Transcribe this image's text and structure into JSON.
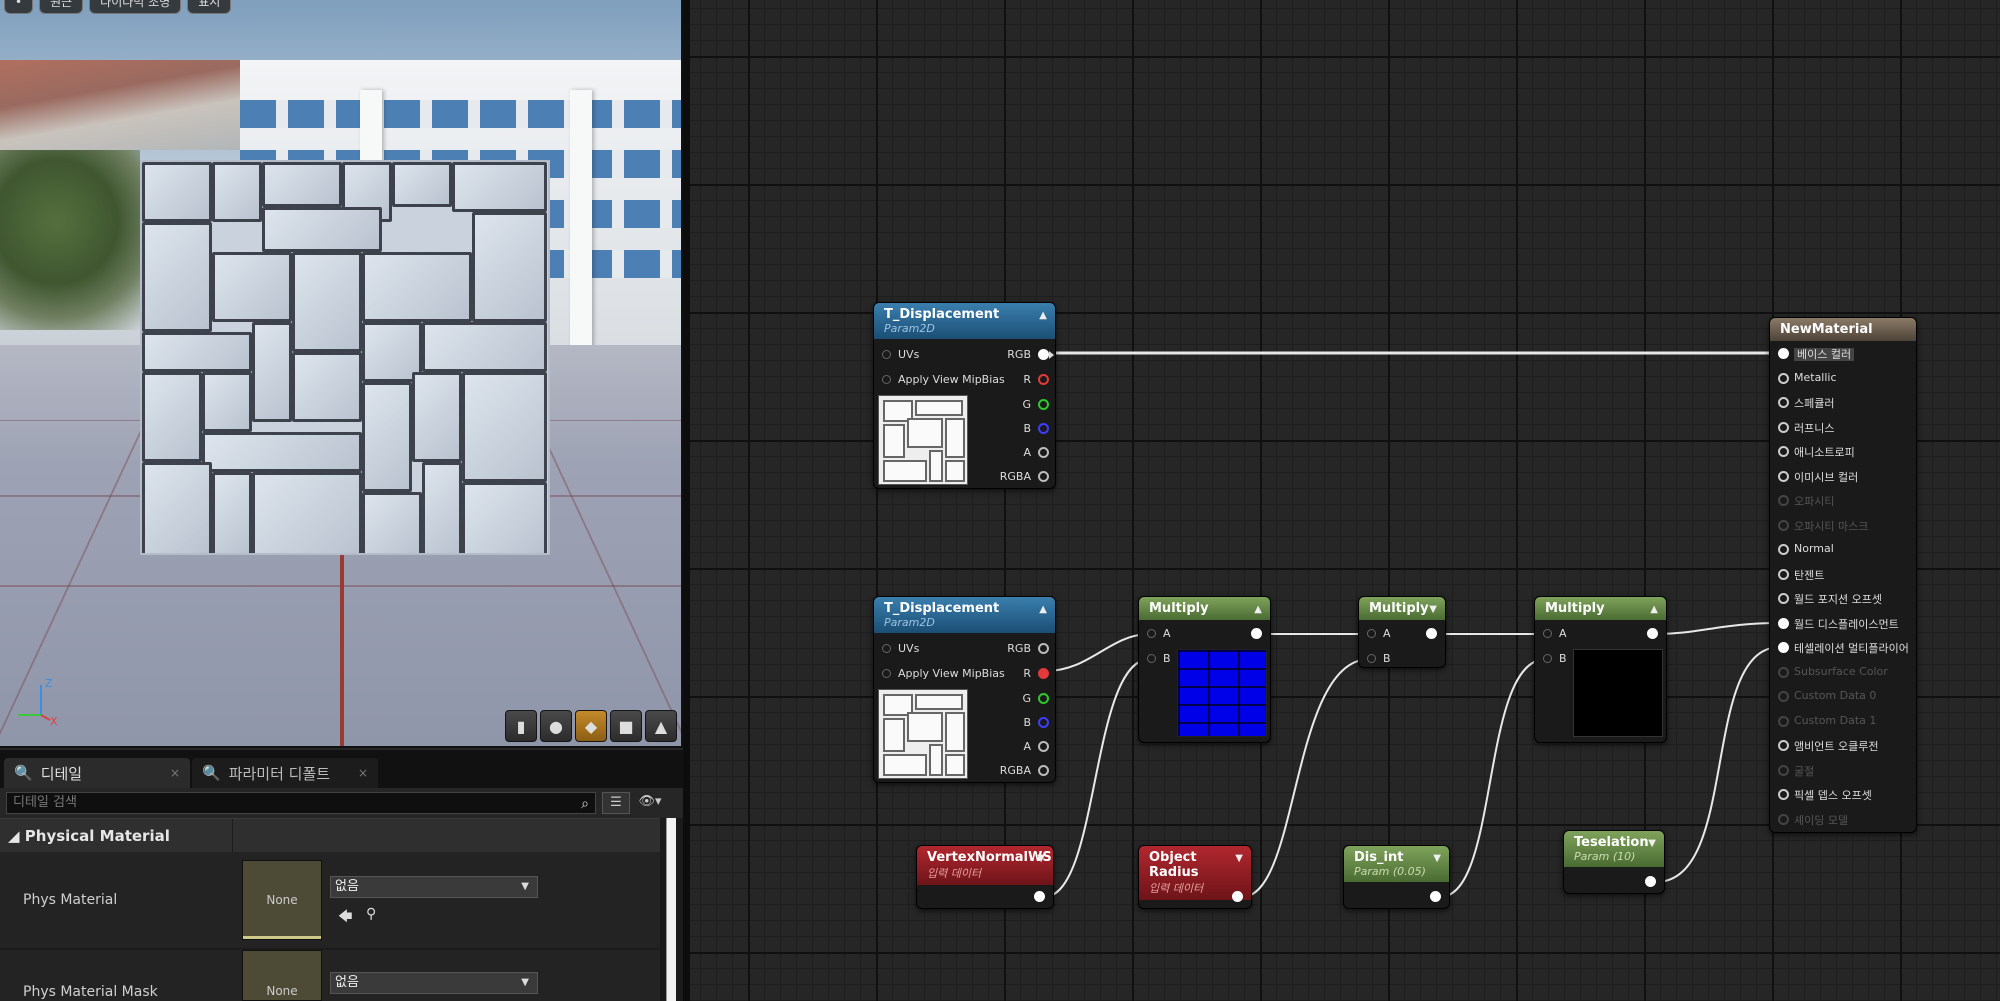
{
  "viewport": {
    "toolbar": [
      "•",
      "원근",
      "다이나믹 조명",
      "표시"
    ],
    "view_buttons": [
      "cylinder-icon",
      "sphere-icon",
      "plane-icon",
      "cube-icon",
      "custom-mesh-icon"
    ],
    "gizmo": {
      "z": "Z",
      "x": "X",
      "y": "Y"
    }
  },
  "details": {
    "tabs": [
      {
        "label": "디테일",
        "close": "×"
      },
      {
        "label": "파라미터 디폴트",
        "close": "×"
      }
    ],
    "search_placeholder": "디테일 검색",
    "category": "Physical Material",
    "properties": [
      {
        "label": "Phys Material",
        "thumb": "None",
        "value": "없음"
      },
      {
        "label": "Phys Material Mask",
        "thumb": "None",
        "value": "없음"
      }
    ]
  },
  "graph": {
    "nodes": {
      "tex1": {
        "title": "T_Displacement",
        "subtitle": "Param2D",
        "inputs": [
          "UVs",
          "Apply View MipBias"
        ],
        "outputs": [
          "RGB",
          "R",
          "G",
          "B",
          "A",
          "RGBA"
        ]
      },
      "tex2": {
        "title": "T_Displacement",
        "subtitle": "Param2D",
        "inputs": [
          "UVs",
          "Apply View MipBias"
        ],
        "outputs": [
          "RGB",
          "R",
          "G",
          "B",
          "A",
          "RGBA"
        ]
      },
      "mul1": {
        "title": "Multiply",
        "a": "A",
        "b": "B"
      },
      "mul2": {
        "title": "Multiply",
        "a": "A",
        "b": "B"
      },
      "mul3": {
        "title": "Multiply",
        "a": "A",
        "b": "B"
      },
      "vnws": {
        "title": "VertexNormalWS",
        "subtitle": "입력 데이터"
      },
      "orad": {
        "title": "Object Radius",
        "subtitle": "입력 데이터"
      },
      "disint": {
        "title": "Dis_int",
        "subtitle": "Param (0.05)"
      },
      "tess": {
        "title": "Teselation",
        "subtitle": "Param (10)"
      },
      "mat": {
        "title": "NewMaterial",
        "pins": [
          {
            "label": "베이스 컬러",
            "enabled": true,
            "connected": true
          },
          {
            "label": "Metallic",
            "enabled": true
          },
          {
            "label": "스페큘러",
            "enabled": true
          },
          {
            "label": "러프니스",
            "enabled": true
          },
          {
            "label": "애니소트로피",
            "enabled": true
          },
          {
            "label": "이미시브 컬러",
            "enabled": true
          },
          {
            "label": "오파시티",
            "enabled": false
          },
          {
            "label": "오파시티 마스크",
            "enabled": false
          },
          {
            "label": "Normal",
            "enabled": true
          },
          {
            "label": "탄젠트",
            "enabled": true
          },
          {
            "label": "월드 포지션 오프셋",
            "enabled": true
          },
          {
            "label": "월드 디스플레이스먼트",
            "enabled": true,
            "connected": true
          },
          {
            "label": "테셀레이션 멀티플라이어",
            "enabled": true,
            "connected": true
          },
          {
            "label": "Subsurface Color",
            "enabled": false
          },
          {
            "label": "Custom Data 0",
            "enabled": false
          },
          {
            "label": "Custom Data 1",
            "enabled": false
          },
          {
            "label": "앰비언트 오클루전",
            "enabled": true
          },
          {
            "label": "굴절",
            "enabled": false
          },
          {
            "label": "픽셀 뎁스 오프셋",
            "enabled": true
          },
          {
            "label": "셰이딩 모델",
            "enabled": false
          }
        ]
      }
    }
  }
}
